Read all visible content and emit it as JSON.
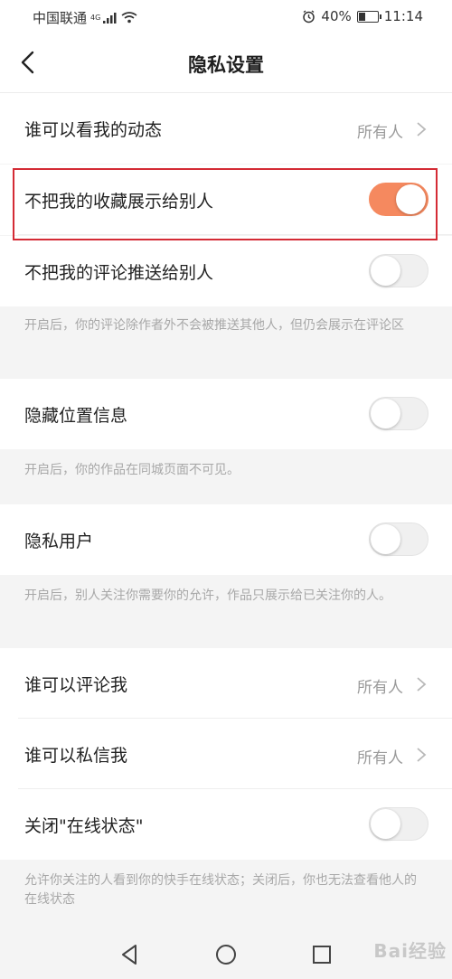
{
  "status_bar": {
    "carrier": "中国联通",
    "network": "4G",
    "battery": "40%",
    "battery_level": 0.4,
    "time": "11:14"
  },
  "header": {
    "title": "隐私设置",
    "back_icon": "chevron-left-icon"
  },
  "rows": {
    "who_can_see_activity": {
      "label": "谁可以看我的动态",
      "value": "所有人"
    },
    "hide_favorites": {
      "label": "不把我的收藏展示给别人",
      "toggle": true
    },
    "no_push_comments": {
      "label": "不把我的评论推送给别人",
      "toggle": false
    },
    "hide_location": {
      "label": "隐藏位置信息",
      "toggle": false
    },
    "private_user": {
      "label": "隐私用户",
      "toggle": false
    },
    "who_can_comment": {
      "label": "谁可以评论我",
      "value": "所有人"
    },
    "who_can_message": {
      "label": "谁可以私信我",
      "value": "所有人"
    },
    "close_online_status": {
      "label": "关闭\"在线状态\"",
      "toggle": false
    }
  },
  "notes": {
    "comments_note": "开启后，你的评论除作者外不会被推送其他人，但仍会展示在评论区",
    "location_note": "开启后，你的作品在同城页面不可见。",
    "private_note": "开启后，别人关注你需要你的允许，作品只展示给已关注你的人。",
    "online_note": "允许你关注的人看到你的快手在线状态；关闭后，你也无法查看他人的在线状态"
  },
  "colors": {
    "accent": "#f5895f",
    "highlight_border": "#d42b35",
    "background": "#f4f4f4"
  },
  "bottom_nav": {
    "back": "triangle-back-icon",
    "home": "circle-home-icon",
    "recents": "square-recents-icon"
  },
  "watermark": "Bai经验"
}
